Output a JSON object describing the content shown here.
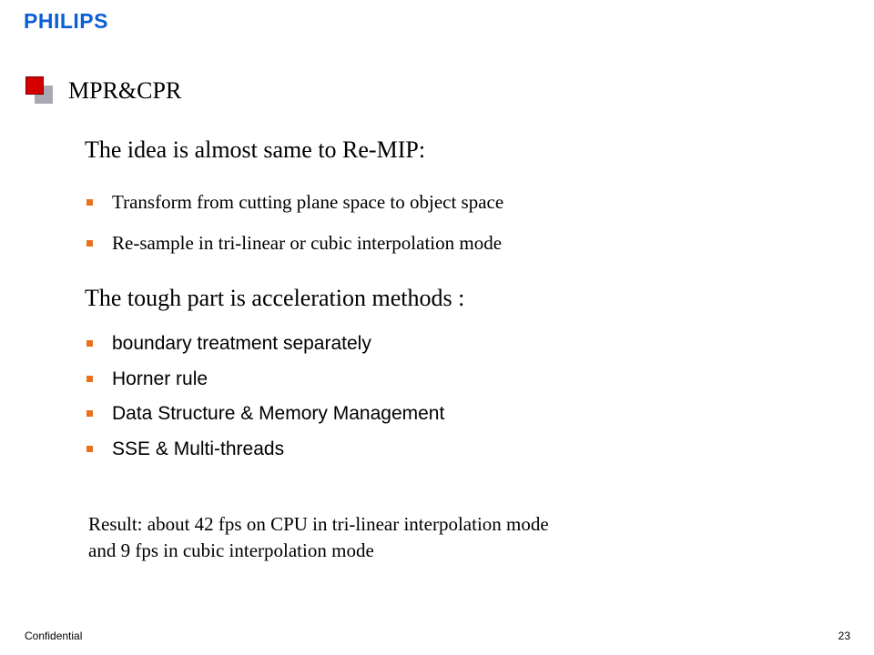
{
  "logo": "PHILIPS",
  "title": "MPR&CPR",
  "section1": {
    "heading": "The idea is almost same to Re-MIP:",
    "bullets": [
      "Transform from cutting plane space to object space",
      "Re-sample in tri-linear or cubic interpolation mode"
    ]
  },
  "section2": {
    "heading": "The tough part is acceleration methods :",
    "bullets": [
      "boundary treatment separately",
      "Horner rule",
      "Data Structure & Memory Management",
      "SSE & Multi-threads"
    ]
  },
  "result": {
    "line1": "Result: about 42 fps on CPU in tri-linear interpolation mode",
    "line2": "and 9 fps in cubic interpolation mode"
  },
  "footer": {
    "confidential": "Confidential",
    "page_number": "23"
  },
  "colors": {
    "logo": "#0b5ed7",
    "bullet": "#e8711e",
    "title_icon_red": "#d40000",
    "title_icon_gray": "#a9a9b3"
  }
}
